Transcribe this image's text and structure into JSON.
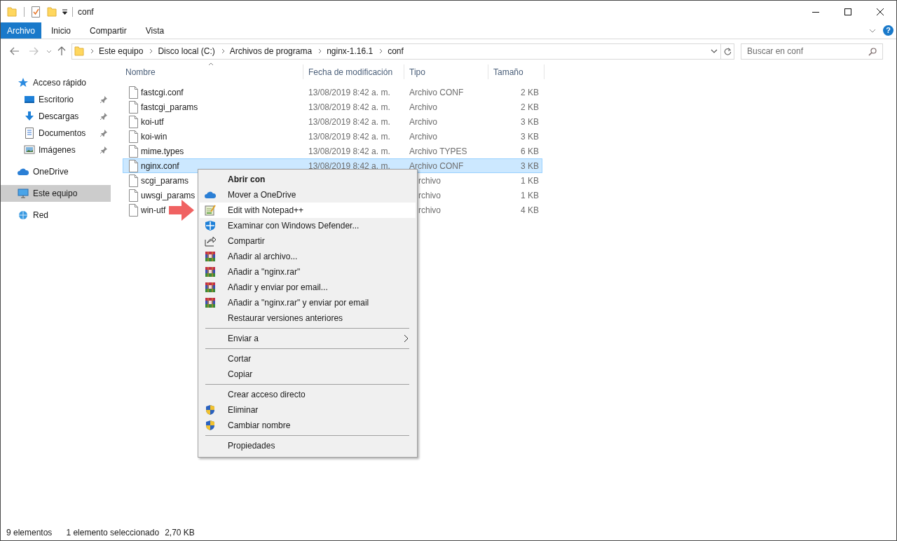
{
  "window": {
    "title": "conf"
  },
  "ribbon": {
    "tabs": [
      {
        "label": "Archivo",
        "kind": "file"
      },
      {
        "label": "Inicio",
        "kind": "tab"
      },
      {
        "label": "Compartir",
        "kind": "tab"
      },
      {
        "label": "Vista",
        "kind": "tab"
      }
    ],
    "help": "?"
  },
  "address_bar": {
    "path": [
      "Este equipo",
      "Disco local (C:)",
      "Archivos de programa",
      "nginx-1.16.1",
      "conf"
    ]
  },
  "search": {
    "placeholder": "Buscar en conf"
  },
  "sidebar": {
    "items": [
      {
        "label": "Acceso rápido",
        "selected": false,
        "children": [
          {
            "label": "Escritorio",
            "pinned": true,
            "selected": false
          },
          {
            "label": "Descargas",
            "pinned": true,
            "selected": false
          },
          {
            "label": "Documentos",
            "pinned": true,
            "selected": false
          },
          {
            "label": "Imágenes",
            "pinned": true,
            "selected": false
          }
        ]
      },
      {
        "label": "OneDrive",
        "selected": false
      },
      {
        "label": "Este equipo",
        "selected": true
      },
      {
        "label": "Red",
        "selected": false
      }
    ]
  },
  "table": {
    "columns": [
      "Nombre",
      "Fecha de modificación",
      "Tipo",
      "Tamaño"
    ],
    "rows": [
      {
        "name": "fastcgi.conf",
        "date": "13/08/2019 8:42 a. m.",
        "type": "Archivo CONF",
        "size": "2 KB",
        "selected": false
      },
      {
        "name": "fastcgi_params",
        "date": "13/08/2019 8:42 a. m.",
        "type": "Archivo",
        "size": "2 KB",
        "selected": false
      },
      {
        "name": "koi-utf",
        "date": "13/08/2019 8:42 a. m.",
        "type": "Archivo",
        "size": "3 KB",
        "selected": false
      },
      {
        "name": "koi-win",
        "date": "13/08/2019 8:42 a. m.",
        "type": "Archivo",
        "size": "3 KB",
        "selected": false
      },
      {
        "name": "mime.types",
        "date": "13/08/2019 8:42 a. m.",
        "type": "Archivo TYPES",
        "size": "6 KB",
        "selected": false
      },
      {
        "name": "nginx.conf",
        "date": "13/08/2019 8:42 a. m.",
        "type": "Archivo CONF",
        "size": "3 KB",
        "selected": true
      },
      {
        "name": "scgi_params",
        "type": "rchivo",
        "size": "1 KB",
        "selected": false
      },
      {
        "name": "uwsgi_params",
        "type": "rchivo",
        "size": "1 KB",
        "selected": false
      },
      {
        "name": "win-utf",
        "type": "rchivo",
        "size": "4 KB",
        "selected": false
      }
    ]
  },
  "context_menu": {
    "items": [
      {
        "kind": "item",
        "label": "Abrir con",
        "default": true,
        "highlighted": false
      },
      {
        "kind": "item",
        "label": "Mover a OneDrive",
        "default": false,
        "highlighted": false
      },
      {
        "kind": "item",
        "label": "Edit with Notepad++",
        "default": false,
        "highlighted": true
      },
      {
        "kind": "item",
        "label": "Examinar con Windows Defender...",
        "default": false,
        "highlighted": false
      },
      {
        "kind": "item",
        "label": "Compartir",
        "default": false,
        "highlighted": false
      },
      {
        "kind": "item",
        "label": "Añadir al archivo...",
        "default": false,
        "highlighted": false
      },
      {
        "kind": "item",
        "label": "Añadir a \"nginx.rar\"",
        "default": false,
        "highlighted": false
      },
      {
        "kind": "item",
        "label": "Añadir y enviar por email...",
        "default": false,
        "highlighted": false
      },
      {
        "kind": "item",
        "label": "Añadir a \"nginx.rar\" y enviar por email",
        "default": false,
        "highlighted": false
      },
      {
        "kind": "item",
        "label": "Restaurar versiones anteriores",
        "default": false,
        "highlighted": false
      },
      {
        "kind": "separator"
      },
      {
        "kind": "item",
        "label": "Enviar a",
        "default": false,
        "highlighted": false,
        "submenu": true
      },
      {
        "kind": "separator"
      },
      {
        "kind": "item",
        "label": "Cortar",
        "default": false,
        "highlighted": false
      },
      {
        "kind": "item",
        "label": "Copiar",
        "default": false,
        "highlighted": false
      },
      {
        "kind": "separator"
      },
      {
        "kind": "item",
        "label": "Crear acceso directo",
        "default": false,
        "highlighted": false
      },
      {
        "kind": "item",
        "label": "Eliminar",
        "default": false,
        "highlighted": false
      },
      {
        "kind": "item",
        "label": "Cambiar nombre",
        "default": false,
        "highlighted": false
      },
      {
        "kind": "separator"
      },
      {
        "kind": "item",
        "label": "Propiedades",
        "default": false,
        "highlighted": false
      }
    ]
  },
  "status_bar": {
    "count": "9 elementos",
    "selection": "1 elemento seleccionado",
    "size": "2,70 KB"
  }
}
